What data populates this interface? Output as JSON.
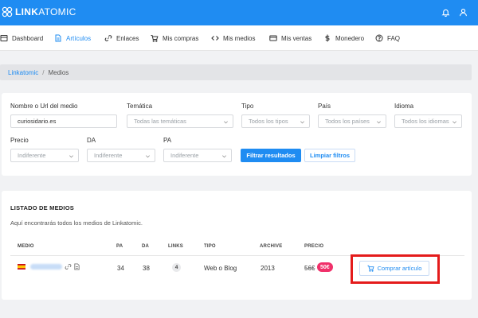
{
  "app": {
    "logo_bold": "LINK",
    "logo_light": "ATOMIC"
  },
  "nav": {
    "items": [
      {
        "label": "Dashboard",
        "icon": "dashboard-icon"
      },
      {
        "label": "Artículos",
        "icon": "document-icon",
        "active": true
      },
      {
        "label": "Enlaces",
        "icon": "link-icon"
      },
      {
        "label": "Mis compras",
        "icon": "cart-icon"
      },
      {
        "label": "Mis medios",
        "icon": "code-icon"
      },
      {
        "label": "Mis ventas",
        "icon": "card-icon"
      },
      {
        "label": "Monedero",
        "icon": "dollar-icon"
      },
      {
        "label": "FAQ",
        "icon": "help-icon"
      }
    ]
  },
  "breadcrumb": {
    "root": "Linkatomic",
    "separator": "/",
    "current": "Medios"
  },
  "filters": {
    "name_label": "Nombre o Url del medio",
    "name_value": "curiosidario.es",
    "tematica_label": "Temática",
    "tematica_value": "Todas las temáticas",
    "tipo_label": "Tipo",
    "tipo_value": "Todos los tipos",
    "pais_label": "País",
    "pais_value": "Todos los países",
    "idioma_label": "Idioma",
    "idioma_value": "Todos los idiomas",
    "precio_label": "Precio",
    "precio_value": "Indiferente",
    "da_label": "DA",
    "da_value": "Indiferente",
    "pa_label": "PA",
    "pa_value": "Indiferente",
    "filter_button": "Filtrar resultados",
    "clear_button": "Limpiar filtros"
  },
  "listing": {
    "title": "LISTADO DE MEDIOS",
    "description": "Aquí encontrarás todos los medios de Linkatomic.",
    "columns": {
      "medio": "MEDIO",
      "pa": "PA",
      "da": "DA",
      "links": "LINKS",
      "tipo": "TIPO",
      "archive": "ARCHIVE",
      "precio": "PRECIO"
    },
    "row": {
      "pa": "34",
      "da": "38",
      "links": "4",
      "tipo": "Web o Blog",
      "archive": "2013",
      "price_old": "56€",
      "price_new": "50€",
      "buy_button": "Comprar artículo"
    }
  },
  "colors": {
    "primary": "#1f8cf2",
    "price_badge": "#f0306a",
    "highlight": "#e41b1b"
  }
}
